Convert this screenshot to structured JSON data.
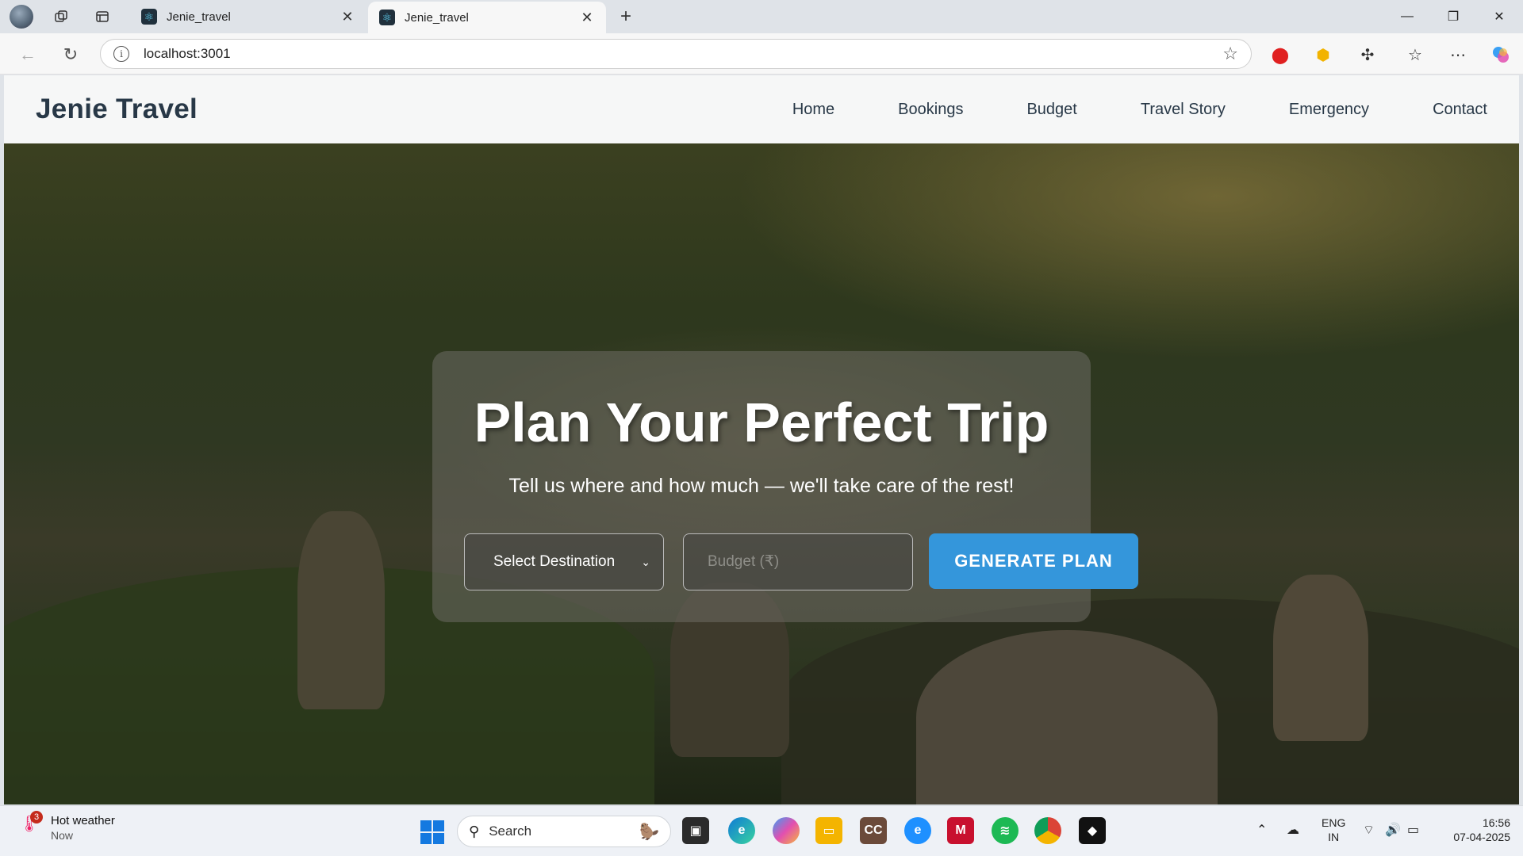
{
  "browser": {
    "tabs": [
      {
        "title": "Jenie_travel"
      },
      {
        "title": "Jenie_travel"
      }
    ],
    "url": "localhost:3001",
    "new_tab_label": "+"
  },
  "site": {
    "brand": "Jenie Travel",
    "nav": [
      "Home",
      "Bookings",
      "Budget",
      "Travel Story",
      "Emergency",
      "Contact"
    ]
  },
  "hero": {
    "title": "Plan Your Perfect Trip",
    "subtitle": "Tell us where and how much — we'll take care of the rest!",
    "destination_select": "Select Destination",
    "budget_placeholder": "Budget (₹)",
    "button": "GENERATE PLAN"
  },
  "taskbar": {
    "weather_title": "Hot weather",
    "weather_time": "Now",
    "weather_badge": "3",
    "search_label": "Search",
    "lang_top": "ENG",
    "lang_bottom": "IN",
    "time": "16:56",
    "date": "07-04-2025"
  },
  "colors": {
    "accent_button": "#3496db",
    "brand_text": "#283847",
    "navbar_bg": "#f6f7f7"
  }
}
